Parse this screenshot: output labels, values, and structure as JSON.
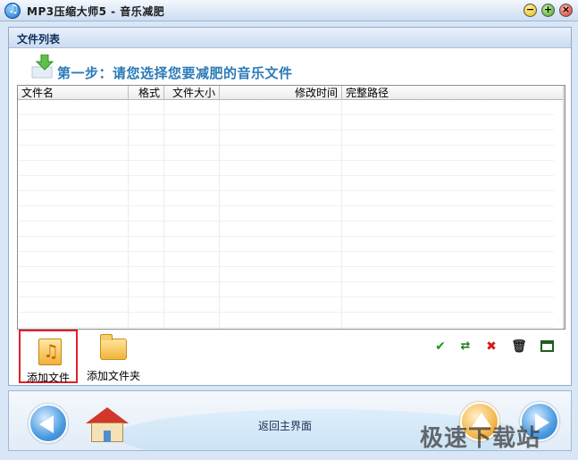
{
  "window": {
    "title": "MP3压缩大师5 - 音乐减肥",
    "controls": {
      "minimize": "−",
      "maximize": "+",
      "close": "×"
    }
  },
  "panel": {
    "header": "文件列表",
    "step_title": "第一步：请您选择您要减肥的音乐文件"
  },
  "table": {
    "columns": [
      "文件名",
      "格式",
      "文件大小",
      "修改时间",
      "完整路径"
    ],
    "rows": []
  },
  "toolbar": {
    "add_file_label": "添加文件",
    "add_folder_label": "添加文件夹",
    "icons": [
      "check-icon",
      "duplicate-icon",
      "delete-icon",
      "trash-icon",
      "window-icon"
    ]
  },
  "footer": {
    "back_to_main_label": "返回主界面"
  },
  "watermark": "极速下载站",
  "colors": {
    "accent": "#2a7ab8",
    "highlight_border": "#e0212b",
    "panel_header_text": "#0f2f5e"
  }
}
